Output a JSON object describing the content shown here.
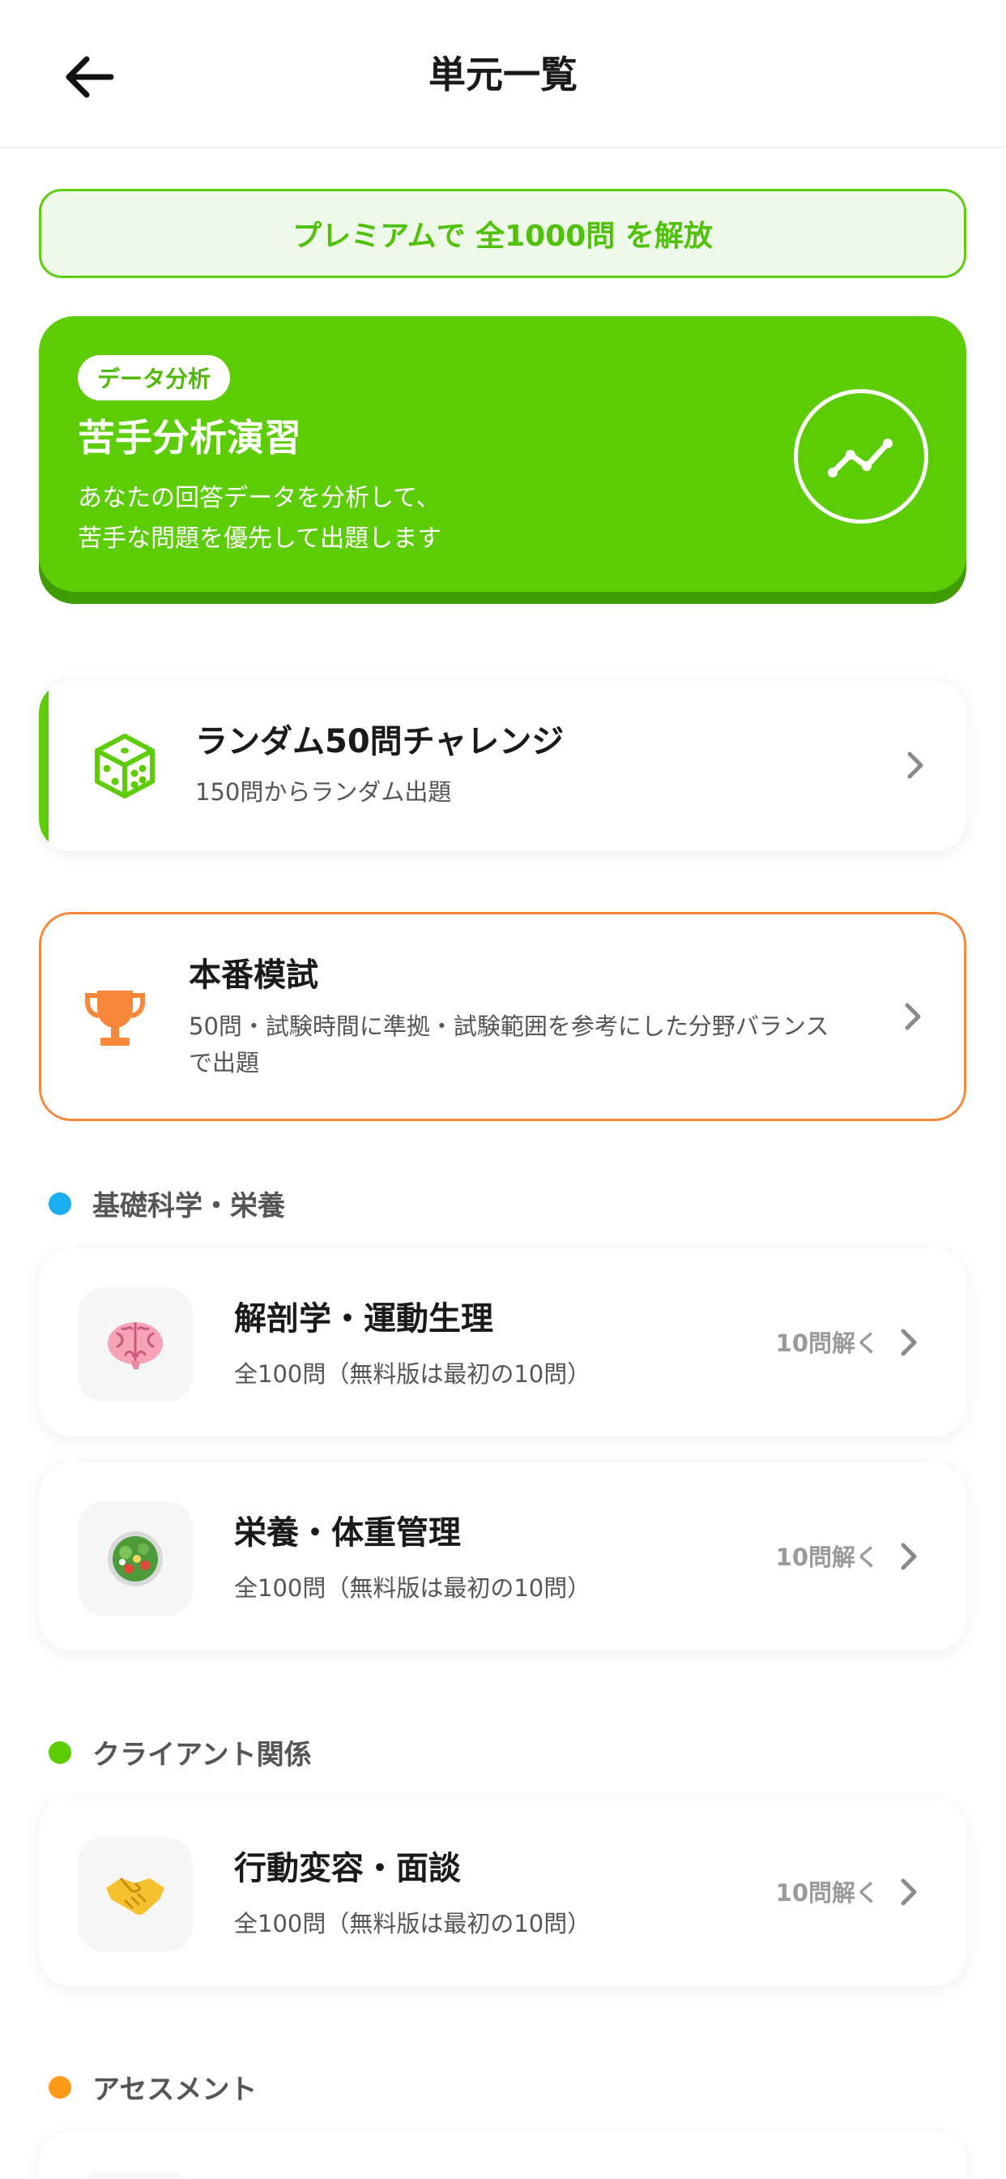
{
  "header": {
    "title": "単元一覧",
    "back_icon": "arrow-left-icon"
  },
  "premium": {
    "label": "プレミアムで 全1000問 を解放",
    "color": "#4fc108"
  },
  "analysis": {
    "badge": "データ分析",
    "title": "苦手分析演習",
    "description_line1": "あなたの回答データを分析して、",
    "description_line2": "苦手な問題を優先して出題します",
    "icon": "trend-chart-icon",
    "color": "#5ccd04"
  },
  "random": {
    "title": "ランダム50問チャレンジ",
    "subtitle": "150問からランダム出題",
    "icon": "dice-icon"
  },
  "exam": {
    "title": "本番模試",
    "subtitle": "50問・試験時間に準拠・試験範囲を参考にした分野バランスで出題",
    "icon": "trophy-icon",
    "color": "#f7873a"
  },
  "sections": [
    {
      "title": "基礎科学・栄養",
      "color": "#1aaef0",
      "units": [
        {
          "title": "解剖学・運動生理",
          "subtitle": "全100問（無料版は最初の10問）",
          "count": "10問解く",
          "icon": "brain-icon"
        },
        {
          "title": "栄養・体重管理",
          "subtitle": "全100問（無料版は最初の10問）",
          "count": "10問解く",
          "icon": "salad-icon"
        }
      ]
    },
    {
      "title": "クライアント関係",
      "color": "#5ccd04",
      "units": [
        {
          "title": "行動変容・面談",
          "subtitle": "全100問（無料版は最初の10問）",
          "count": "10問解く",
          "icon": "handshake-icon"
        }
      ]
    },
    {
      "title": "アセスメント",
      "color": "#ff9a1a",
      "units": []
    }
  ]
}
